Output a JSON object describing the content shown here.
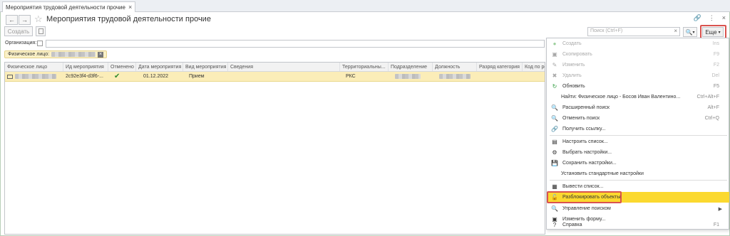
{
  "tab": {
    "title": "Мероприятия трудовой деятельности прочие",
    "close": "×"
  },
  "header": {
    "title": "Мероприятия трудовой деятельности прочие",
    "back": "←",
    "forward": "→",
    "star": "☆",
    "link_icon": "🔗",
    "more_icon": "⋮",
    "close_icon": "×"
  },
  "toolbar": {
    "create_label": "Создать",
    "search_placeholder": "Поиск (Ctrl+F)",
    "search_clear": "×",
    "more_label": "Еще"
  },
  "filter": {
    "org_label": "Организация:",
    "tag_label": "Физическое лицо:",
    "tag_close": "×"
  },
  "table": {
    "columns": [
      "Физическое лицо",
      "Ид мероприятия",
      "Отменено",
      "Дата мероприятия",
      "Вид мероприятия",
      "Сведения",
      "Территориальны...",
      "Подразделение",
      "Должность",
      "Разряд категория",
      "Код по ре"
    ],
    "rows": [
      {
        "person": "",
        "id": "2c92e3f4-d3f6-...",
        "cancelled": "✔",
        "date": "01.12.2022",
        "kind": "Прием",
        "info": "",
        "territory": "РКС",
        "dept": "",
        "position": "",
        "grade": "",
        "code": ""
      }
    ]
  },
  "menu": {
    "items": [
      {
        "label": "Создать",
        "key": "Ins",
        "icon": "●",
        "disabled": true
      },
      {
        "label": "Скопировать",
        "key": "F9",
        "icon": "▣",
        "disabled": true
      },
      {
        "label": "Изменить",
        "key": "F2",
        "icon": "✎",
        "disabled": true
      },
      {
        "label": "Удалить",
        "key": "Del",
        "icon": "✖",
        "disabled": true
      },
      {
        "label": "Обновить",
        "key": "F5",
        "icon": "↻",
        "disabled": false
      },
      {
        "label": "Найти: Физическое лицо - Босов Иван Валентино...",
        "key": "Ctrl+Alt+F",
        "icon": "",
        "disabled": false
      },
      {
        "label": "Расширенный поиск",
        "key": "Alt+F",
        "icon": "🔍",
        "disabled": false
      },
      {
        "label": "Отменить поиск",
        "key": "Ctrl+Q",
        "icon": "🔍",
        "disabled": false
      },
      {
        "label": "Получить ссылку...",
        "key": "",
        "icon": "🔗",
        "disabled": false
      },
      {
        "label": "Настроить список...",
        "key": "",
        "icon": "▤",
        "disabled": false
      },
      {
        "label": "Выбрать настройки...",
        "key": "",
        "icon": "⚙",
        "disabled": false
      },
      {
        "label": "Сохранить настройки...",
        "key": "",
        "icon": "💾",
        "disabled": false
      },
      {
        "label": "Установить стандартные настройки",
        "key": "",
        "icon": "",
        "disabled": false
      },
      {
        "label": "Вывести список...",
        "key": "",
        "icon": "▦",
        "disabled": false
      },
      {
        "label": "Разблокировать объекты",
        "key": "",
        "icon": "🔓",
        "disabled": false
      },
      {
        "label": "Управление поиском",
        "key": "▶",
        "icon": "🔍",
        "disabled": false
      },
      {
        "label": "Изменить форму...",
        "key": "",
        "icon": "▣",
        "disabled": false
      },
      {
        "label": "Справка",
        "key": "F1",
        "icon": "?",
        "disabled": false
      }
    ]
  },
  "colors": {
    "highlight": "#fbd92f",
    "selected_row": "#fbedb8",
    "red_frame": "#d9534f"
  }
}
